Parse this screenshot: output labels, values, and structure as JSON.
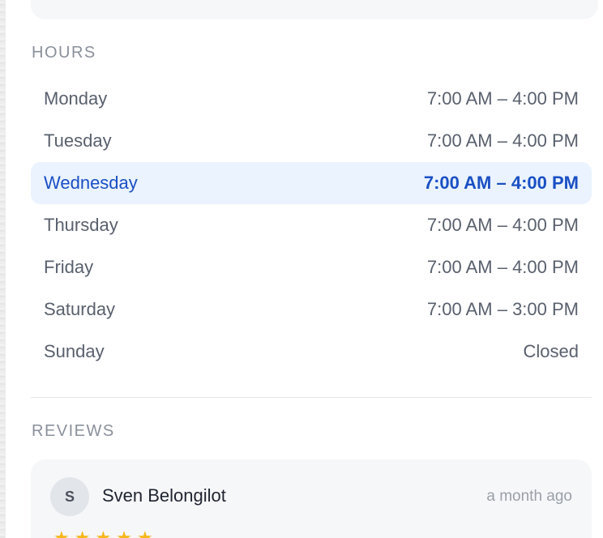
{
  "hours": {
    "label": "HOURS",
    "rows": [
      {
        "day": "Monday",
        "time": "7:00 AM – 4:00 PM",
        "today": false
      },
      {
        "day": "Tuesday",
        "time": "7:00 AM – 4:00 PM",
        "today": false
      },
      {
        "day": "Wednesday",
        "time": "7:00 AM – 4:00 PM",
        "today": true
      },
      {
        "day": "Thursday",
        "time": "7:00 AM – 4:00 PM",
        "today": false
      },
      {
        "day": "Friday",
        "time": "7:00 AM – 4:00 PM",
        "today": false
      },
      {
        "day": "Saturday",
        "time": "7:00 AM – 3:00 PM",
        "today": false
      },
      {
        "day": "Sunday",
        "time": "Closed",
        "today": false
      }
    ]
  },
  "reviews": {
    "label": "REVIEWS",
    "items": [
      {
        "avatar_initial": "S",
        "name": "Sven Belongilot",
        "time": "a month ago",
        "rating": 5
      }
    ]
  },
  "colors": {
    "highlight_bg": "#eaf3ff",
    "highlight_text": "#1a4fc4",
    "star": "#f5b81c"
  }
}
